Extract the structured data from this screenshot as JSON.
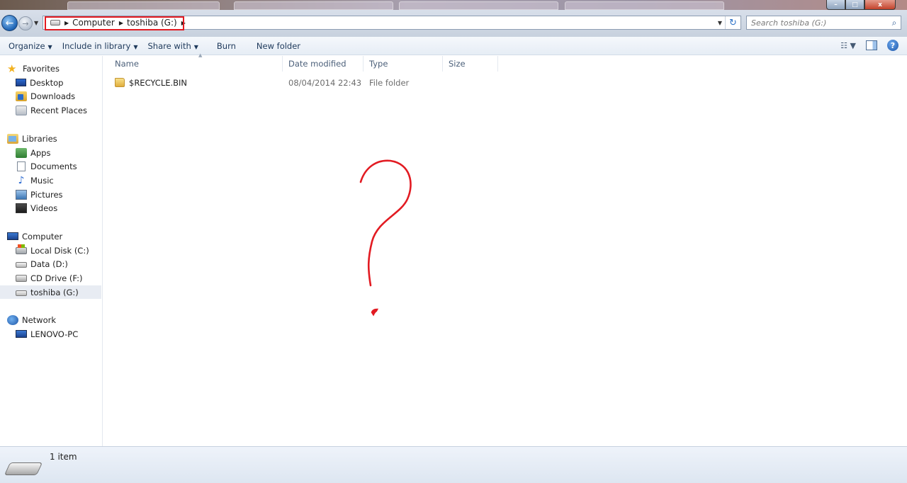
{
  "window": {
    "controls": {
      "minimize": "–",
      "maximize": "□",
      "close": "x"
    }
  },
  "address_bar": {
    "breadcrumbs": [
      "Computer",
      "toshiba (G:)"
    ],
    "back_glyph": "←",
    "forward_glyph": "→",
    "refresh_glyph": "↻"
  },
  "search": {
    "placeholder": "Search toshiba (G:)"
  },
  "toolbar": {
    "organize": "Organize",
    "include_in_library": "Include in library",
    "share_with": "Share with",
    "burn": "Burn",
    "new_folder": "New folder",
    "help": "?"
  },
  "sidebar": {
    "favorites": {
      "label": "Favorites",
      "items": [
        "Desktop",
        "Downloads",
        "Recent Places"
      ]
    },
    "libraries": {
      "label": "Libraries",
      "items": [
        "Apps",
        "Documents",
        "Music",
        "Pictures",
        "Videos"
      ]
    },
    "computer": {
      "label": "Computer",
      "items": [
        "Local Disk (C:)",
        "Data (D:)",
        "CD Drive (F:)",
        "toshiba (G:)"
      ],
      "selected": "toshiba (G:)"
    },
    "network": {
      "label": "Network",
      "items": [
        "LENOVO-PC"
      ]
    }
  },
  "file_list": {
    "columns": [
      "Name",
      "Date modified",
      "Type",
      "Size"
    ],
    "rows": [
      {
        "name": "$RECYCLE.BIN",
        "date_modified": "08/04/2014 22:43",
        "type": "File folder",
        "size": ""
      }
    ]
  },
  "annotation": {
    "shape": "question-mark",
    "color": "#e21b22"
  },
  "status_bar": {
    "item_count": "1 item"
  }
}
